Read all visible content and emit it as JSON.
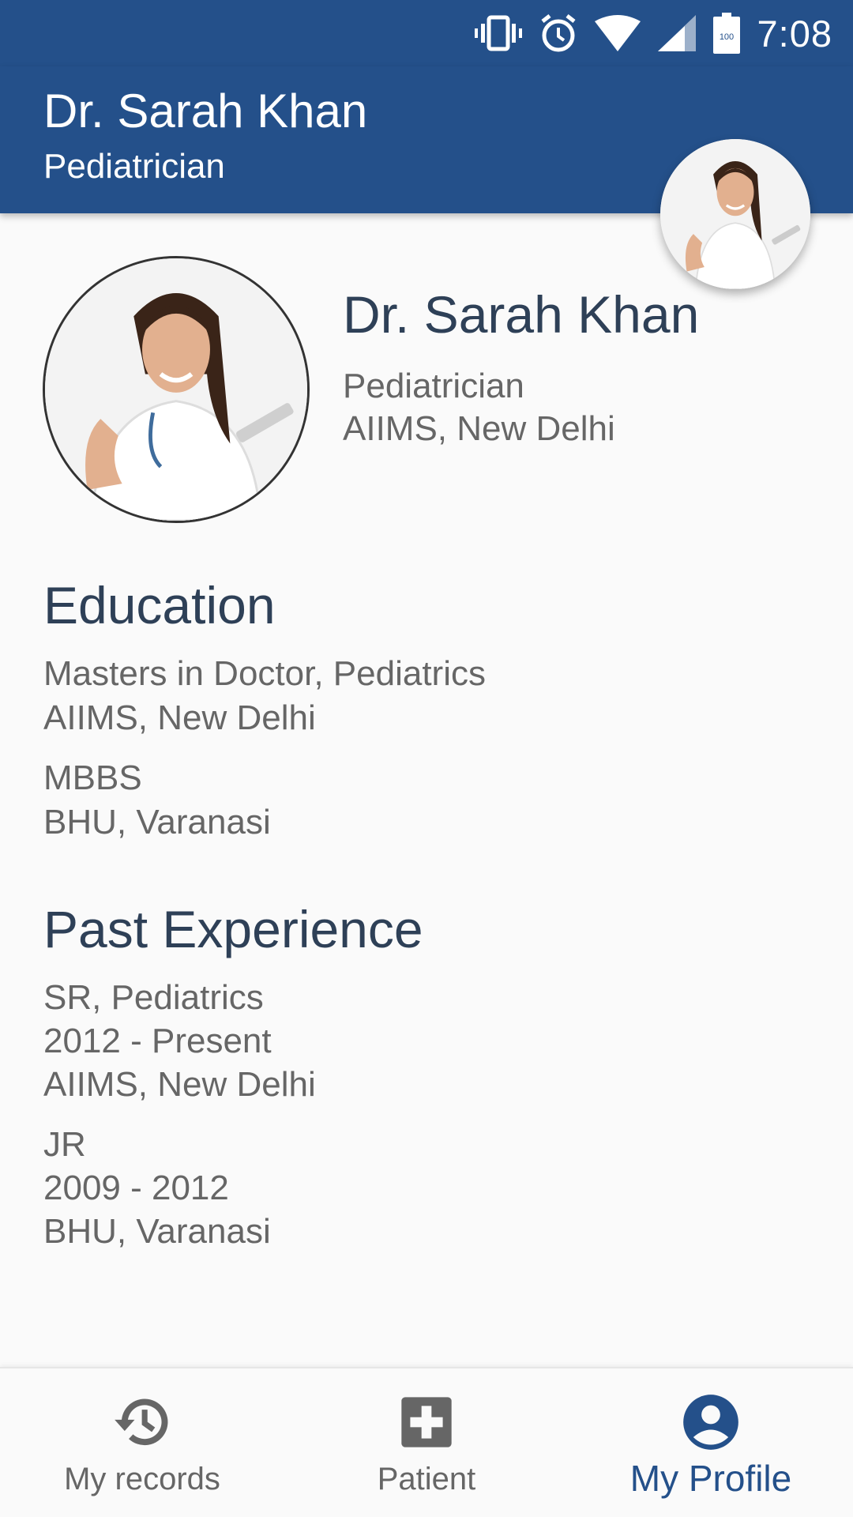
{
  "status_bar": {
    "time": "7:08",
    "battery": "100",
    "icons": [
      "vibrate-icon",
      "alarm-icon",
      "wifi-icon",
      "signal-icon",
      "battery-icon"
    ]
  },
  "app_bar": {
    "title": "Dr. Sarah Khan",
    "subtitle": "Pediatrician"
  },
  "profile": {
    "name": "Dr. Sarah Khan",
    "specialty": "Pediatrician",
    "hospital": "AIIMS, New Delhi"
  },
  "education": {
    "title": "Education",
    "entries": [
      {
        "degree": "Masters in Doctor, Pediatrics",
        "institution": "AIIMS, New Delhi"
      },
      {
        "degree": "MBBS",
        "institution": "BHU, Varanasi"
      }
    ]
  },
  "experience": {
    "title": "Past Experience",
    "entries": [
      {
        "role": "SR, Pediatrics",
        "period": "2012 - Present",
        "place": "AIIMS, New Delhi"
      },
      {
        "role": "JR",
        "period": "2009 - 2012",
        "place": "BHU, Varanasi"
      }
    ]
  },
  "bottom_nav": {
    "items": [
      {
        "label": "My records",
        "icon": "history-icon",
        "active": false
      },
      {
        "label": "Patient",
        "icon": "medical-cross-icon",
        "active": false
      },
      {
        "label": "My Profile",
        "icon": "account-circle-icon",
        "active": true
      }
    ]
  },
  "colors": {
    "primary": "#24508a",
    "heading": "#2e4057",
    "body_text": "#666666",
    "background": "#fafafa"
  }
}
